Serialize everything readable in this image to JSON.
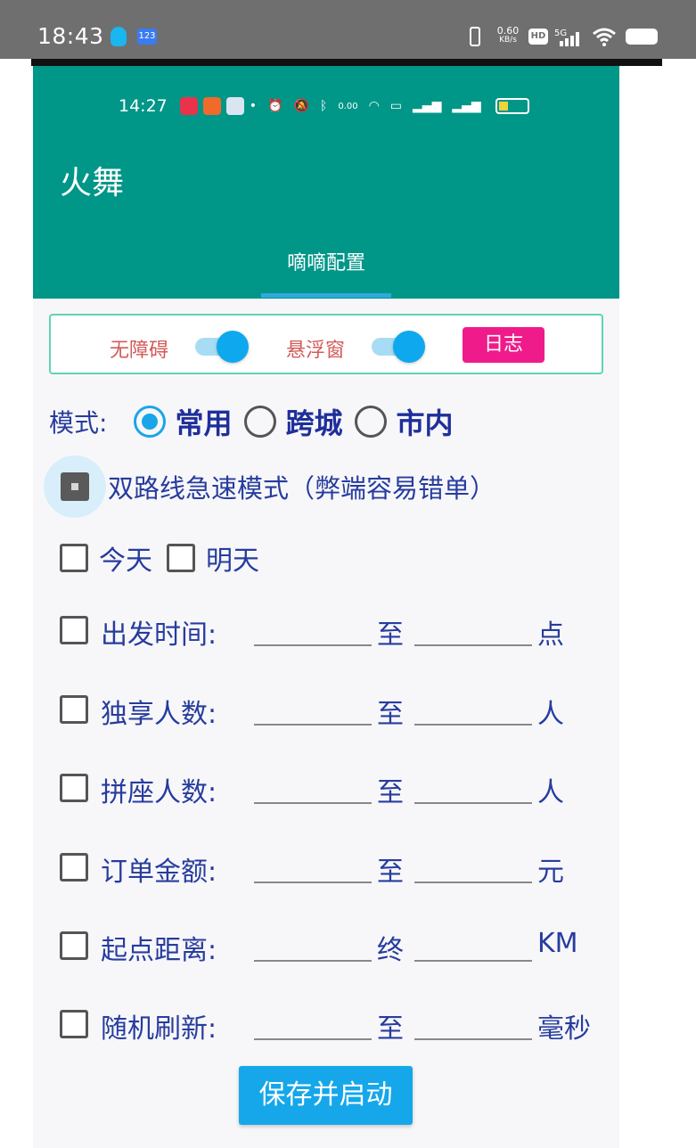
{
  "device_status": {
    "time": "18:43",
    "app_badge": "123",
    "net_speed_value": "0.60",
    "net_speed_unit": "KB/s",
    "hd_label": "HD",
    "network_label": "5G"
  },
  "app_status": {
    "time": "14:27",
    "net_speed": "0.00"
  },
  "app": {
    "title": "火舞",
    "tab_label": "嘀嘀配置",
    "header_color": "#009688"
  },
  "toggles": {
    "accessibility_label": "无障碍",
    "accessibility_on": true,
    "floating_window_label": "悬浮窗",
    "floating_window_on": true,
    "log_button_label": "日志"
  },
  "mode": {
    "label": "模式:",
    "options": [
      {
        "label": "常用",
        "selected": true
      },
      {
        "label": "跨城",
        "selected": false
      },
      {
        "label": "市内",
        "selected": false
      }
    ]
  },
  "fast_mode": {
    "label": "双路线急速模式（弊端容易错单）",
    "checked": true
  },
  "days": {
    "today_label": "今天",
    "tomorrow_label": "明天"
  },
  "filters": [
    {
      "label": "出发时间:",
      "separator": "至",
      "unit": "点",
      "from": "",
      "to": ""
    },
    {
      "label": "独享人数:",
      "separator": "至",
      "unit": "人",
      "from": "",
      "to": ""
    },
    {
      "label": "拼座人数:",
      "separator": "至",
      "unit": "人",
      "from": "",
      "to": ""
    },
    {
      "label": "订单金额:",
      "separator": "至",
      "unit": "元",
      "from": "",
      "to": ""
    },
    {
      "label": "起点距离:",
      "separator": "终",
      "unit": "KM",
      "from": "",
      "to": ""
    },
    {
      "label": "随机刷新:",
      "separator": "至",
      "unit": "毫秒",
      "from": "",
      "to": ""
    }
  ],
  "save_button_label": "保存并启动",
  "icons": {
    "qq": "qq-icon",
    "vibrate": "vibrate-icon",
    "signal": "signal-icon",
    "wifi": "wifi-icon",
    "battery": "battery-icon"
  }
}
